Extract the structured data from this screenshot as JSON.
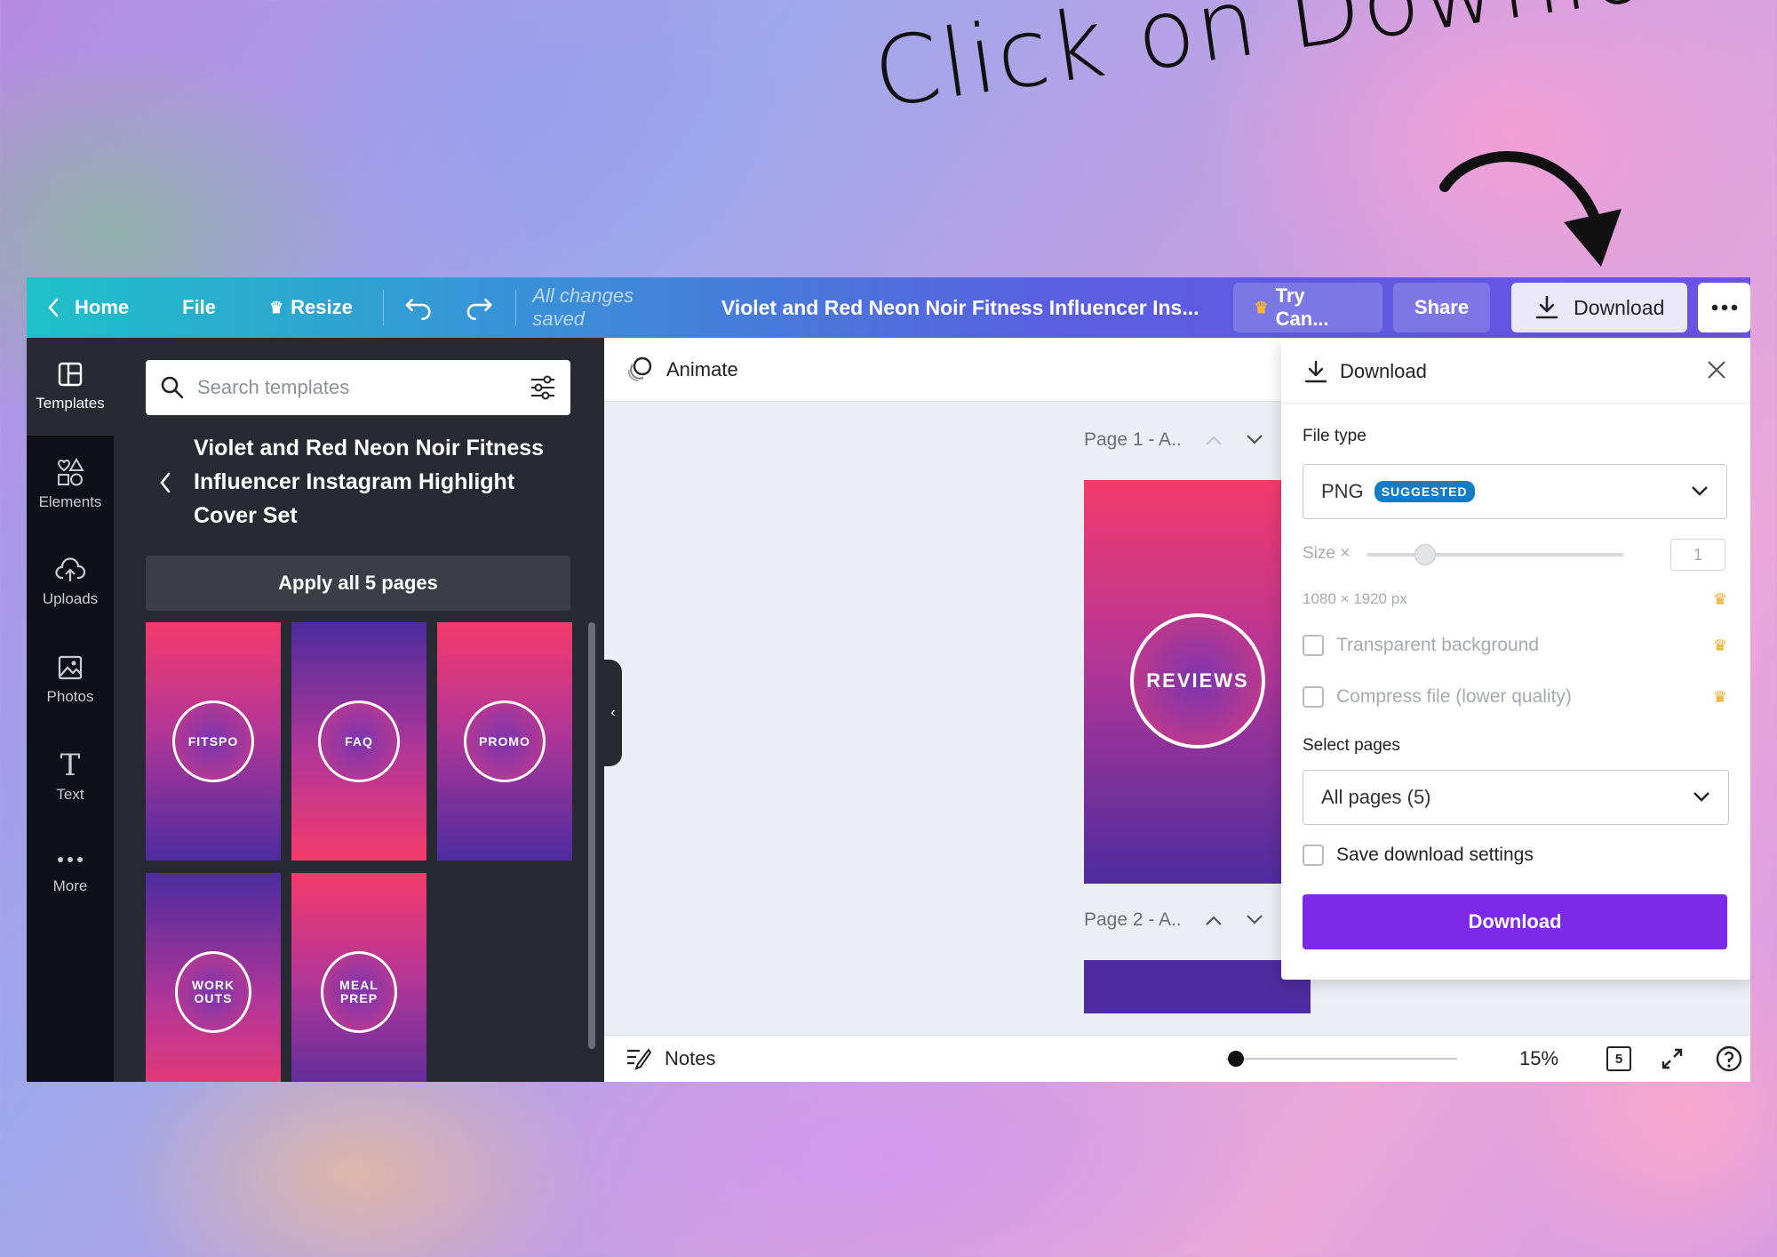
{
  "headline": "Click on Download",
  "topbar": {
    "home_label": "Home",
    "file_label": "File",
    "resize_label": "Resize",
    "saved_status": "All changes saved",
    "doc_title": "Violet and Red Neon Noir Fitness Influencer Ins...",
    "try_label": "Try Can...",
    "share_label": "Share",
    "download_label": "Download"
  },
  "rail": {
    "items": [
      {
        "label": "Templates",
        "icon": "templates-icon"
      },
      {
        "label": "Elements",
        "icon": "elements-icon"
      },
      {
        "label": "Uploads",
        "icon": "uploads-icon"
      },
      {
        "label": "Photos",
        "icon": "photos-icon"
      },
      {
        "label": "Text",
        "icon": "text-icon"
      },
      {
        "label": "More",
        "icon": "more-icon"
      }
    ]
  },
  "panel": {
    "search_placeholder": "Search templates",
    "template_title": "Violet and Red Neon Noir Fitness Influencer Instagram Highlight Cover Set",
    "apply_label": "Apply all 5 pages",
    "thumbs": [
      {
        "label": "FITSPO"
      },
      {
        "label": "FAQ"
      },
      {
        "label": "PROMO"
      },
      {
        "label": "WORK OUTS"
      },
      {
        "label": "MEAL PREP"
      }
    ]
  },
  "workspace": {
    "animate_label": "Animate",
    "page1_label": "Page 1 - A..",
    "page2_label": "Page 2 - A..",
    "page1_text": "REVIEWS",
    "notes_label": "Notes",
    "zoom": "15%",
    "page_count": "5"
  },
  "download_panel": {
    "title": "Download",
    "file_type_label": "File type",
    "file_type_value": "PNG",
    "suggested_badge": "SUGGESTED",
    "size_label": "Size ×",
    "size_value": "1",
    "dimensions": "1080 × 1920 px",
    "transparent_label": "Transparent background",
    "compress_label": "Compress file (lower quality)",
    "select_pages_label": "Select pages",
    "pages_value": "All pages (5)",
    "save_settings_label": "Save download settings",
    "download_button": "Download"
  },
  "colors": {
    "accent": "#7d2ae8",
    "badge": "#137cc4",
    "crown": "#f2a81d",
    "panel_dark": "#272a33"
  }
}
